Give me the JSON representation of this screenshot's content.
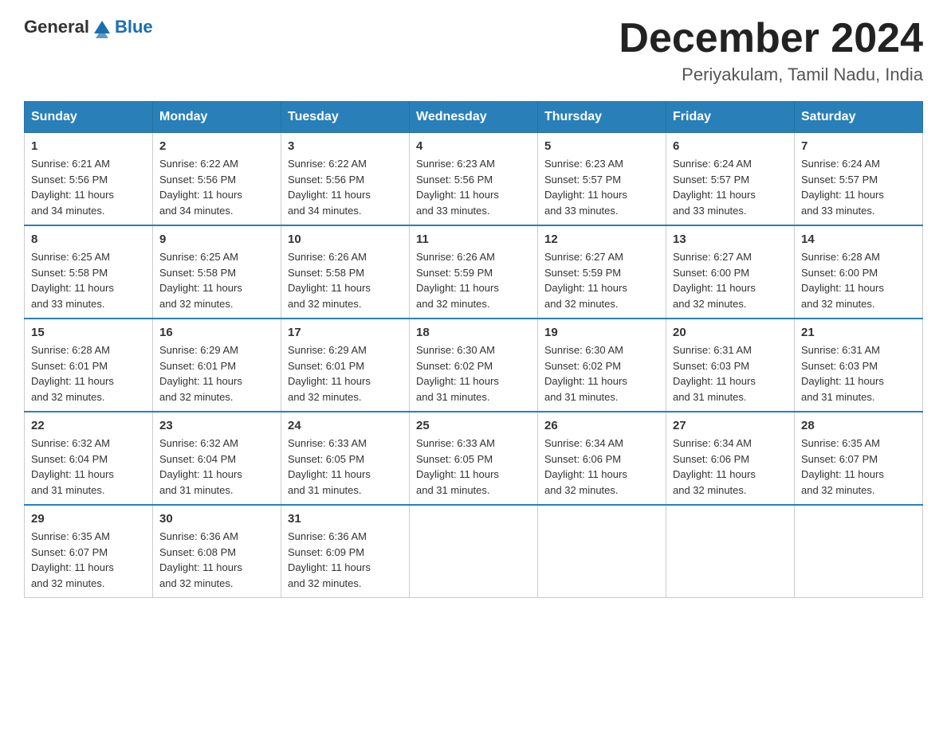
{
  "header": {
    "logo_general": "General",
    "logo_blue": "Blue",
    "month_title": "December 2024",
    "location": "Periyakulam, Tamil Nadu, India"
  },
  "days_of_week": [
    "Sunday",
    "Monday",
    "Tuesday",
    "Wednesday",
    "Thursday",
    "Friday",
    "Saturday"
  ],
  "weeks": [
    [
      {
        "day": "1",
        "sunrise": "6:21 AM",
        "sunset": "5:56 PM",
        "daylight": "11 hours and 34 minutes."
      },
      {
        "day": "2",
        "sunrise": "6:22 AM",
        "sunset": "5:56 PM",
        "daylight": "11 hours and 34 minutes."
      },
      {
        "day": "3",
        "sunrise": "6:22 AM",
        "sunset": "5:56 PM",
        "daylight": "11 hours and 34 minutes."
      },
      {
        "day": "4",
        "sunrise": "6:23 AM",
        "sunset": "5:56 PM",
        "daylight": "11 hours and 33 minutes."
      },
      {
        "day": "5",
        "sunrise": "6:23 AM",
        "sunset": "5:57 PM",
        "daylight": "11 hours and 33 minutes."
      },
      {
        "day": "6",
        "sunrise": "6:24 AM",
        "sunset": "5:57 PM",
        "daylight": "11 hours and 33 minutes."
      },
      {
        "day": "7",
        "sunrise": "6:24 AM",
        "sunset": "5:57 PM",
        "daylight": "11 hours and 33 minutes."
      }
    ],
    [
      {
        "day": "8",
        "sunrise": "6:25 AM",
        "sunset": "5:58 PM",
        "daylight": "11 hours and 33 minutes."
      },
      {
        "day": "9",
        "sunrise": "6:25 AM",
        "sunset": "5:58 PM",
        "daylight": "11 hours and 32 minutes."
      },
      {
        "day": "10",
        "sunrise": "6:26 AM",
        "sunset": "5:58 PM",
        "daylight": "11 hours and 32 minutes."
      },
      {
        "day": "11",
        "sunrise": "6:26 AM",
        "sunset": "5:59 PM",
        "daylight": "11 hours and 32 minutes."
      },
      {
        "day": "12",
        "sunrise": "6:27 AM",
        "sunset": "5:59 PM",
        "daylight": "11 hours and 32 minutes."
      },
      {
        "day": "13",
        "sunrise": "6:27 AM",
        "sunset": "6:00 PM",
        "daylight": "11 hours and 32 minutes."
      },
      {
        "day": "14",
        "sunrise": "6:28 AM",
        "sunset": "6:00 PM",
        "daylight": "11 hours and 32 minutes."
      }
    ],
    [
      {
        "day": "15",
        "sunrise": "6:28 AM",
        "sunset": "6:01 PM",
        "daylight": "11 hours and 32 minutes."
      },
      {
        "day": "16",
        "sunrise": "6:29 AM",
        "sunset": "6:01 PM",
        "daylight": "11 hours and 32 minutes."
      },
      {
        "day": "17",
        "sunrise": "6:29 AM",
        "sunset": "6:01 PM",
        "daylight": "11 hours and 32 minutes."
      },
      {
        "day": "18",
        "sunrise": "6:30 AM",
        "sunset": "6:02 PM",
        "daylight": "11 hours and 31 minutes."
      },
      {
        "day": "19",
        "sunrise": "6:30 AM",
        "sunset": "6:02 PM",
        "daylight": "11 hours and 31 minutes."
      },
      {
        "day": "20",
        "sunrise": "6:31 AM",
        "sunset": "6:03 PM",
        "daylight": "11 hours and 31 minutes."
      },
      {
        "day": "21",
        "sunrise": "6:31 AM",
        "sunset": "6:03 PM",
        "daylight": "11 hours and 31 minutes."
      }
    ],
    [
      {
        "day": "22",
        "sunrise": "6:32 AM",
        "sunset": "6:04 PM",
        "daylight": "11 hours and 31 minutes."
      },
      {
        "day": "23",
        "sunrise": "6:32 AM",
        "sunset": "6:04 PM",
        "daylight": "11 hours and 31 minutes."
      },
      {
        "day": "24",
        "sunrise": "6:33 AM",
        "sunset": "6:05 PM",
        "daylight": "11 hours and 31 minutes."
      },
      {
        "day": "25",
        "sunrise": "6:33 AM",
        "sunset": "6:05 PM",
        "daylight": "11 hours and 31 minutes."
      },
      {
        "day": "26",
        "sunrise": "6:34 AM",
        "sunset": "6:06 PM",
        "daylight": "11 hours and 32 minutes."
      },
      {
        "day": "27",
        "sunrise": "6:34 AM",
        "sunset": "6:06 PM",
        "daylight": "11 hours and 32 minutes."
      },
      {
        "day": "28",
        "sunrise": "6:35 AM",
        "sunset": "6:07 PM",
        "daylight": "11 hours and 32 minutes."
      }
    ],
    [
      {
        "day": "29",
        "sunrise": "6:35 AM",
        "sunset": "6:07 PM",
        "daylight": "11 hours and 32 minutes."
      },
      {
        "day": "30",
        "sunrise": "6:36 AM",
        "sunset": "6:08 PM",
        "daylight": "11 hours and 32 minutes."
      },
      {
        "day": "31",
        "sunrise": "6:36 AM",
        "sunset": "6:09 PM",
        "daylight": "11 hours and 32 minutes."
      },
      null,
      null,
      null,
      null
    ]
  ],
  "labels": {
    "sunrise": "Sunrise:",
    "sunset": "Sunset:",
    "daylight": "Daylight:"
  }
}
